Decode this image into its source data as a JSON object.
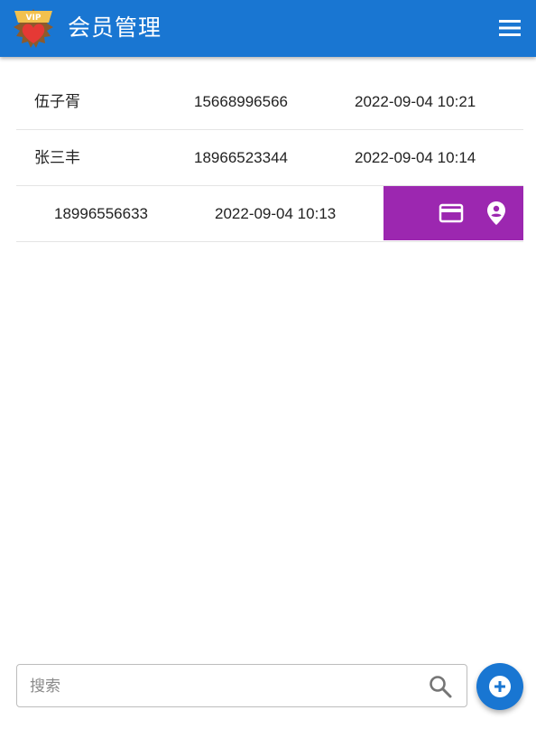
{
  "header": {
    "title": "会员管理",
    "logo_text": "VIP",
    "logo_icon": "vip-heart-badge",
    "menu_icon": "hamburger-menu-icon",
    "color": "#1976d2"
  },
  "members": [
    {
      "name": "伍子胥",
      "phone": "15668996566",
      "date": "2022-09-04 10:21"
    },
    {
      "name": "张三丰",
      "phone": "18966523344",
      "date": "2022-09-04 10:14"
    },
    {
      "name": "",
      "phone": "18996556633",
      "date": "2022-09-04 10:13"
    }
  ],
  "row_actions": {
    "color": "#9c27b0",
    "buttons": [
      {
        "icon": "credit-card-icon"
      },
      {
        "icon": "location-pin-icon"
      }
    ]
  },
  "search": {
    "placeholder": "搜索",
    "value": "",
    "icon": "search-icon"
  },
  "fab": {
    "icon": "add-circle-icon",
    "color": "#1976d2"
  }
}
